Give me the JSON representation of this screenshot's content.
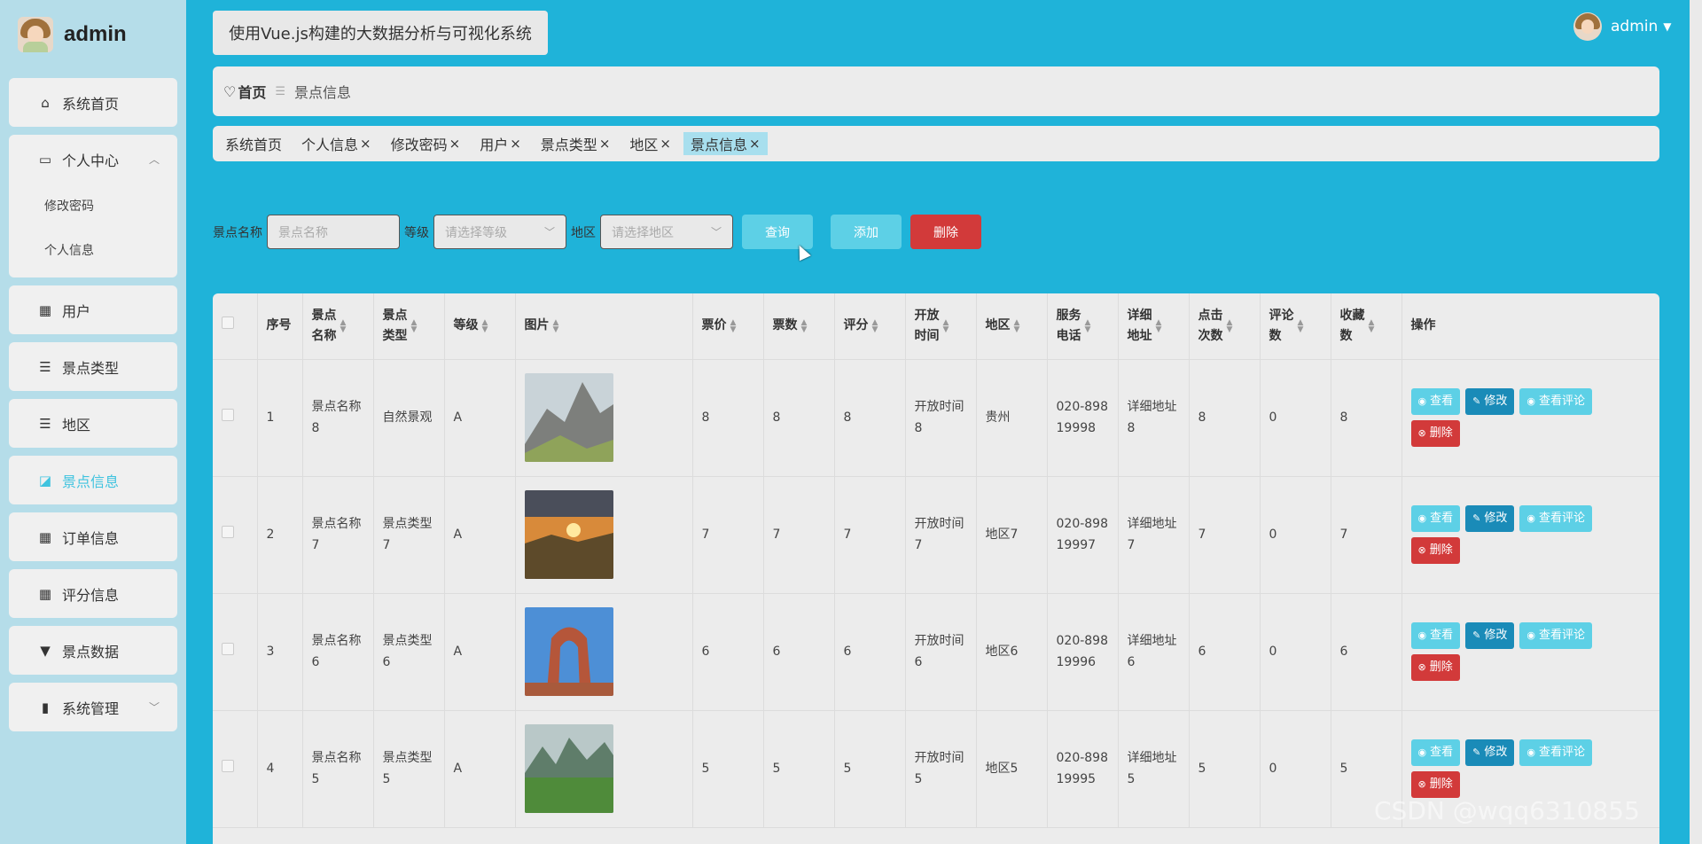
{
  "brand": {
    "name": "admin"
  },
  "sidebar": {
    "items": [
      {
        "label": "系统首页",
        "icon": "home-icon"
      },
      {
        "label": "个人中心",
        "icon": "calendar-icon",
        "expanded": true,
        "children": [
          "修改密码",
          "个人信息"
        ]
      },
      {
        "label": "用户",
        "icon": "grid-icon"
      },
      {
        "label": "景点类型",
        "icon": "list-icon"
      },
      {
        "label": "地区",
        "icon": "list-icon"
      },
      {
        "label": "景点信息",
        "icon": "chart-icon",
        "active": true
      },
      {
        "label": "订单信息",
        "icon": "grid-icon"
      },
      {
        "label": "评分信息",
        "icon": "grid-icon"
      },
      {
        "label": "景点数据",
        "icon": "pin-icon"
      },
      {
        "label": "系统管理",
        "icon": "book-icon"
      }
    ]
  },
  "header": {
    "title": "使用Vue.js构建的大数据分析与可视化系统",
    "user": "admin"
  },
  "breadcrumb": {
    "home": "首页",
    "current": "景点信息"
  },
  "tags": [
    "系统首页",
    "个人信息",
    "修改密码",
    "用户",
    "景点类型",
    "地区",
    "景点信息"
  ],
  "filters": {
    "name_label": "景点名称",
    "name_placeholder": "景点名称",
    "level_label": "等级",
    "level_placeholder": "请选择等级",
    "region_label": "地区",
    "region_placeholder": "请选择地区",
    "query": "查询",
    "add": "添加",
    "delete": "删除"
  },
  "table": {
    "headers": [
      "序号",
      "景点\n名称",
      "景点\n类型",
      "等级",
      "图片",
      "票价",
      "票数",
      "评分",
      "开放\n时间",
      "地区",
      "服务\n电话",
      "详细\n地址",
      "点击\n次数",
      "评论\n数",
      "收藏\n数",
      "操作"
    ],
    "ops": {
      "view": "查看",
      "edit": "修改",
      "comment": "查看评论",
      "delete": "删除"
    },
    "rows": [
      {
        "no": "1",
        "name": "景点名称8",
        "type": "自然景观",
        "level": "A",
        "img": "mountain",
        "price": "8",
        "tickets": "8",
        "score": "8",
        "open": "开放时间8",
        "region": "贵州",
        "phone": "020-89819998",
        "addr": "详细地址8",
        "clicks": "8",
        "comments": "0",
        "favs": "8"
      },
      {
        "no": "2",
        "name": "景点名称7",
        "type": "景点类型7",
        "level": "A",
        "img": "sunset",
        "price": "7",
        "tickets": "7",
        "score": "7",
        "open": "开放时间7",
        "region": "地区7",
        "phone": "020-89819997",
        "addr": "详细地址7",
        "clicks": "7",
        "comments": "0",
        "favs": "7"
      },
      {
        "no": "3",
        "name": "景点名称6",
        "type": "景点类型6",
        "level": "A",
        "img": "arch",
        "price": "6",
        "tickets": "6",
        "score": "6",
        "open": "开放时间6",
        "region": "地区6",
        "phone": "020-89819996",
        "addr": "详细地址6",
        "clicks": "6",
        "comments": "0",
        "favs": "6"
      },
      {
        "no": "4",
        "name": "景点名称5",
        "type": "景点类型5",
        "level": "A",
        "img": "green",
        "price": "5",
        "tickets": "5",
        "score": "5",
        "open": "开放时间5",
        "region": "地区5",
        "phone": "020-89819995",
        "addr": "详细地址5",
        "clicks": "5",
        "comments": "0",
        "favs": "5"
      }
    ]
  },
  "watermark": "CSDN @wqq6310855",
  "colors": {
    "bg": "#1fb3d9",
    "sidebar": "#b5dde9",
    "accent": "#5dd0e6",
    "danger": "#d23a3a",
    "edit": "#1a8bb8"
  }
}
